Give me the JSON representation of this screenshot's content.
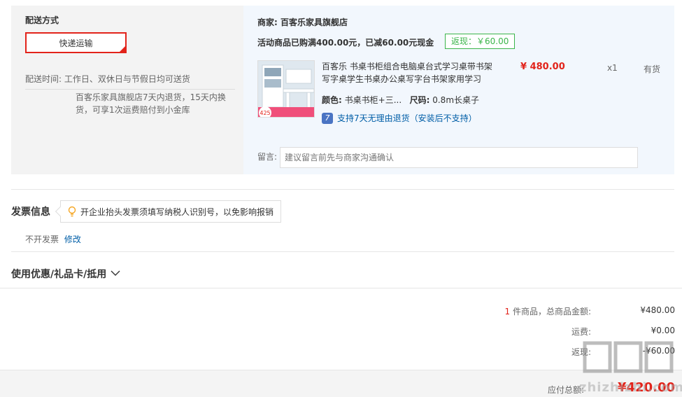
{
  "delivery": {
    "section_title": "配送方式",
    "method_label": "快递运输",
    "time_label": "配送时间:",
    "time_value": "工作日、双休日与节假日均可送货",
    "return_policy": "百客乐家具旗舰店7天内退货，15天内换货，可享1次运费赔付到小金库"
  },
  "order": {
    "merchant_label": "商家:",
    "merchant_name": "百客乐家具旗舰店",
    "promo_text": "活动商品已购满400.00元，已减60.00元现金",
    "rebate_badge": "返现：￥60.00",
    "product": {
      "image_promo_price": "425",
      "name": "百客乐 书桌书柜组合电脑桌台式学习桌带书架写字桌学生书桌办公桌写字台书架家用学习",
      "price": "¥ 480.00",
      "qty": "x1",
      "stock": "有货",
      "color_label": "颜色:",
      "color_value": "书桌书柜+三...",
      "size_label": "尺码:",
      "size_value": "0.8m长桌子",
      "return_support": "支持7天无理由退货（安装后不支持）",
      "return_icon": "7"
    },
    "memo_label": "留言:",
    "memo_placeholder": "建议留言前先与商家沟通确认"
  },
  "invoice": {
    "title": "发票信息",
    "tip": "开企业抬头发票须填写纳税人识别号，以免影响报销",
    "status": "不开发票",
    "modify_link": "修改"
  },
  "coupon": {
    "title": "使用优惠/礼品卡/抵用"
  },
  "summary": {
    "item_count": "1",
    "items_label": "件商品，总商品金额:",
    "items_total": "¥480.00",
    "shipping_label": "运费:",
    "shipping_value": "¥0.00",
    "rebate_label": "返现:",
    "rebate_value": "-¥60.00",
    "payable_label": "应付总额:",
    "payable_value": "¥420.00"
  },
  "watermark": {
    "text": "zhizhizhi.com"
  },
  "colors": {
    "accent_red": "#e2231a",
    "link_blue": "#005ea7",
    "rebate_green": "#3bb54a"
  }
}
